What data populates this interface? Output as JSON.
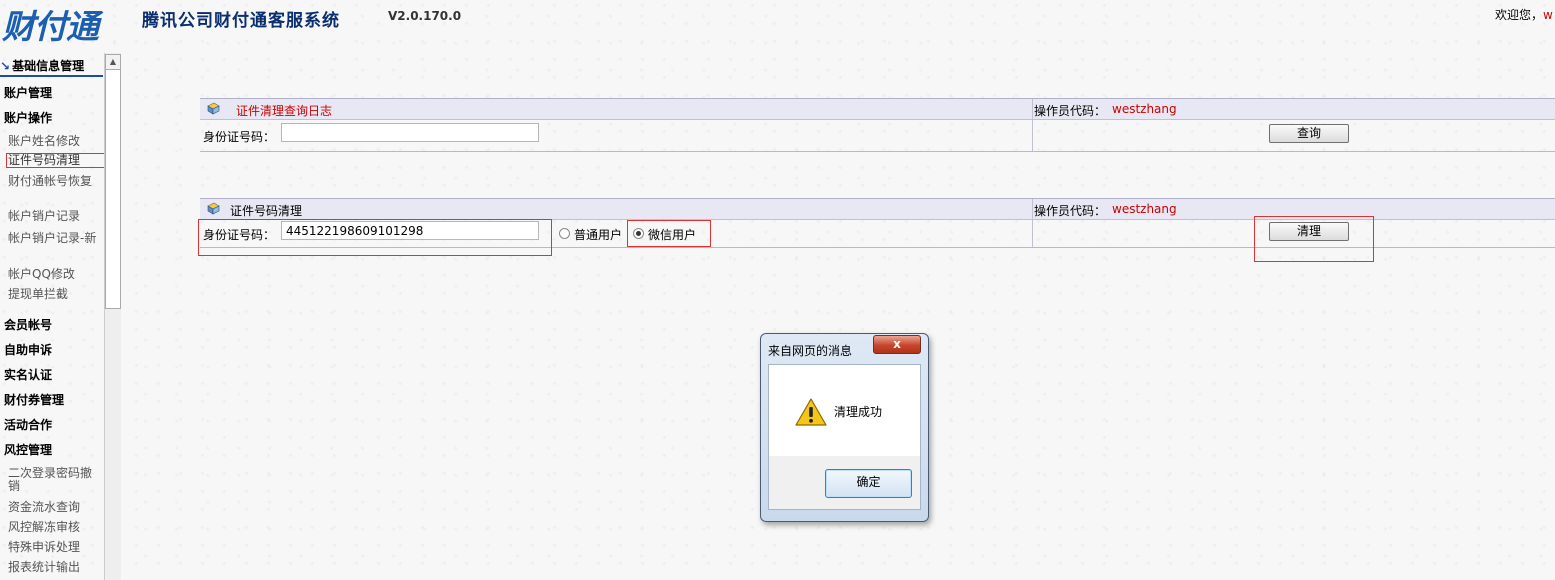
{
  "header": {
    "logo_text": "财付通",
    "system_title": "腾讯公司财付通客服系统",
    "version": "V2.0.170.0",
    "welcome_prefix": "欢迎您，",
    "welcome_user": "w"
  },
  "sidebar": {
    "section_title": "基础信息管理",
    "items": [
      {
        "label": "账户管理",
        "type": "category"
      },
      {
        "label": "账户操作",
        "type": "category"
      },
      {
        "label": "账户姓名修改",
        "type": "item"
      },
      {
        "label": "证件号码清理",
        "type": "item",
        "selected": true
      },
      {
        "label": "财付通帐号恢复",
        "type": "item"
      },
      {
        "label": "帐户销户记录",
        "type": "item"
      },
      {
        "label": "帐户销户记录-新",
        "type": "item"
      },
      {
        "label": "帐户QQ修改",
        "type": "item"
      },
      {
        "label": "提现单拦截",
        "type": "item"
      },
      {
        "label": "会员帐号",
        "type": "category"
      },
      {
        "label": "自助申诉",
        "type": "category"
      },
      {
        "label": "实名认证",
        "type": "category"
      },
      {
        "label": "财付券管理",
        "type": "category"
      },
      {
        "label": "活动合作",
        "type": "category"
      },
      {
        "label": "风控管理",
        "type": "category"
      },
      {
        "label": "二次登录密码撤销",
        "type": "item"
      },
      {
        "label": "资金流水查询",
        "type": "item"
      },
      {
        "label": "风控解冻审核",
        "type": "item"
      },
      {
        "label": "特殊申诉处理",
        "type": "item"
      },
      {
        "label": "报表统计输出",
        "type": "item"
      }
    ]
  },
  "query_panel": {
    "title": "证件清理查询日志",
    "operator_label": "操作员代码：",
    "operator_value": "westzhang",
    "id_label": "身份证号码：",
    "id_value": "",
    "button_label": "查询"
  },
  "clean_panel": {
    "title": "证件号码清理",
    "operator_label": "操作员代码：",
    "operator_value": "westzhang",
    "id_label": "身份证号码：",
    "id_value": "445122198609101298",
    "radio_normal_label": "普通用户",
    "radio_wechat_label": "微信用户",
    "selected_radio": "微信用户",
    "button_label": "清理"
  },
  "dialog": {
    "title": "来自网页的消息",
    "close_label": "x",
    "message": "清理成功",
    "ok_label": "确定",
    "icon": "warning-icon"
  },
  "colors": {
    "title_blue": "#0a2e6e",
    "operator_red": "#cc0000",
    "panel_header": "#e8e8f4",
    "highlight_red": "#dd3333"
  }
}
